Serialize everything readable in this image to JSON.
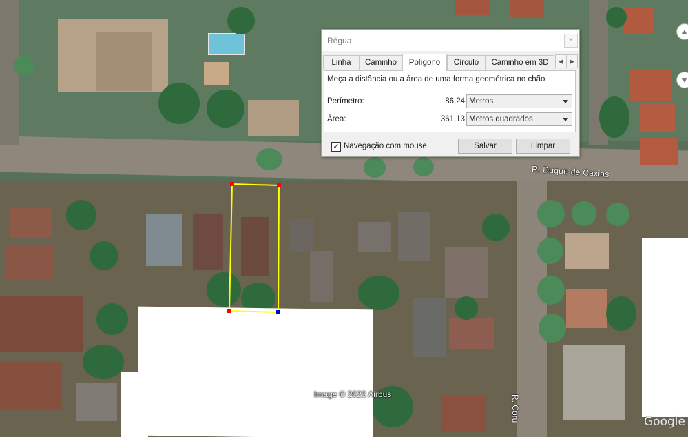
{
  "map": {
    "street_labels": [
      "R. Duque de Caxias",
      "R. Coru"
    ],
    "attribution": "Image © 2023 Airbus",
    "logo": "Google",
    "polygon_colors": {
      "edge": "#ffff00",
      "vertex_red": "#ff0000",
      "vertex_blue": "#0000ff"
    }
  },
  "dialog": {
    "title": "Régua",
    "close_glyph": "×",
    "tabs": [
      {
        "label": "Linha"
      },
      {
        "label": "Caminho"
      },
      {
        "label": "Polígono",
        "active": true
      },
      {
        "label": "Círculo"
      },
      {
        "label": "Caminho em 3D"
      }
    ],
    "description": "Meça a distância ou a área de uma forma geométrica no chão",
    "perimeter": {
      "label": "Perímetro:",
      "value": "86,24",
      "unit": "Metros"
    },
    "area": {
      "label": "Área:",
      "value": "361,13",
      "unit": "Metros quadrados"
    },
    "mouse_nav": {
      "label": "Navegação com mouse",
      "checked": true,
      "mark": "✓"
    },
    "buttons": {
      "save": "Salvar",
      "clear": "Limpar"
    }
  },
  "icons": {
    "tab_scroll_left": "chevron-left-icon",
    "tab_scroll_right": "chevron-right-icon",
    "nav_up": "up-icon",
    "nav_down": "down-icon"
  }
}
